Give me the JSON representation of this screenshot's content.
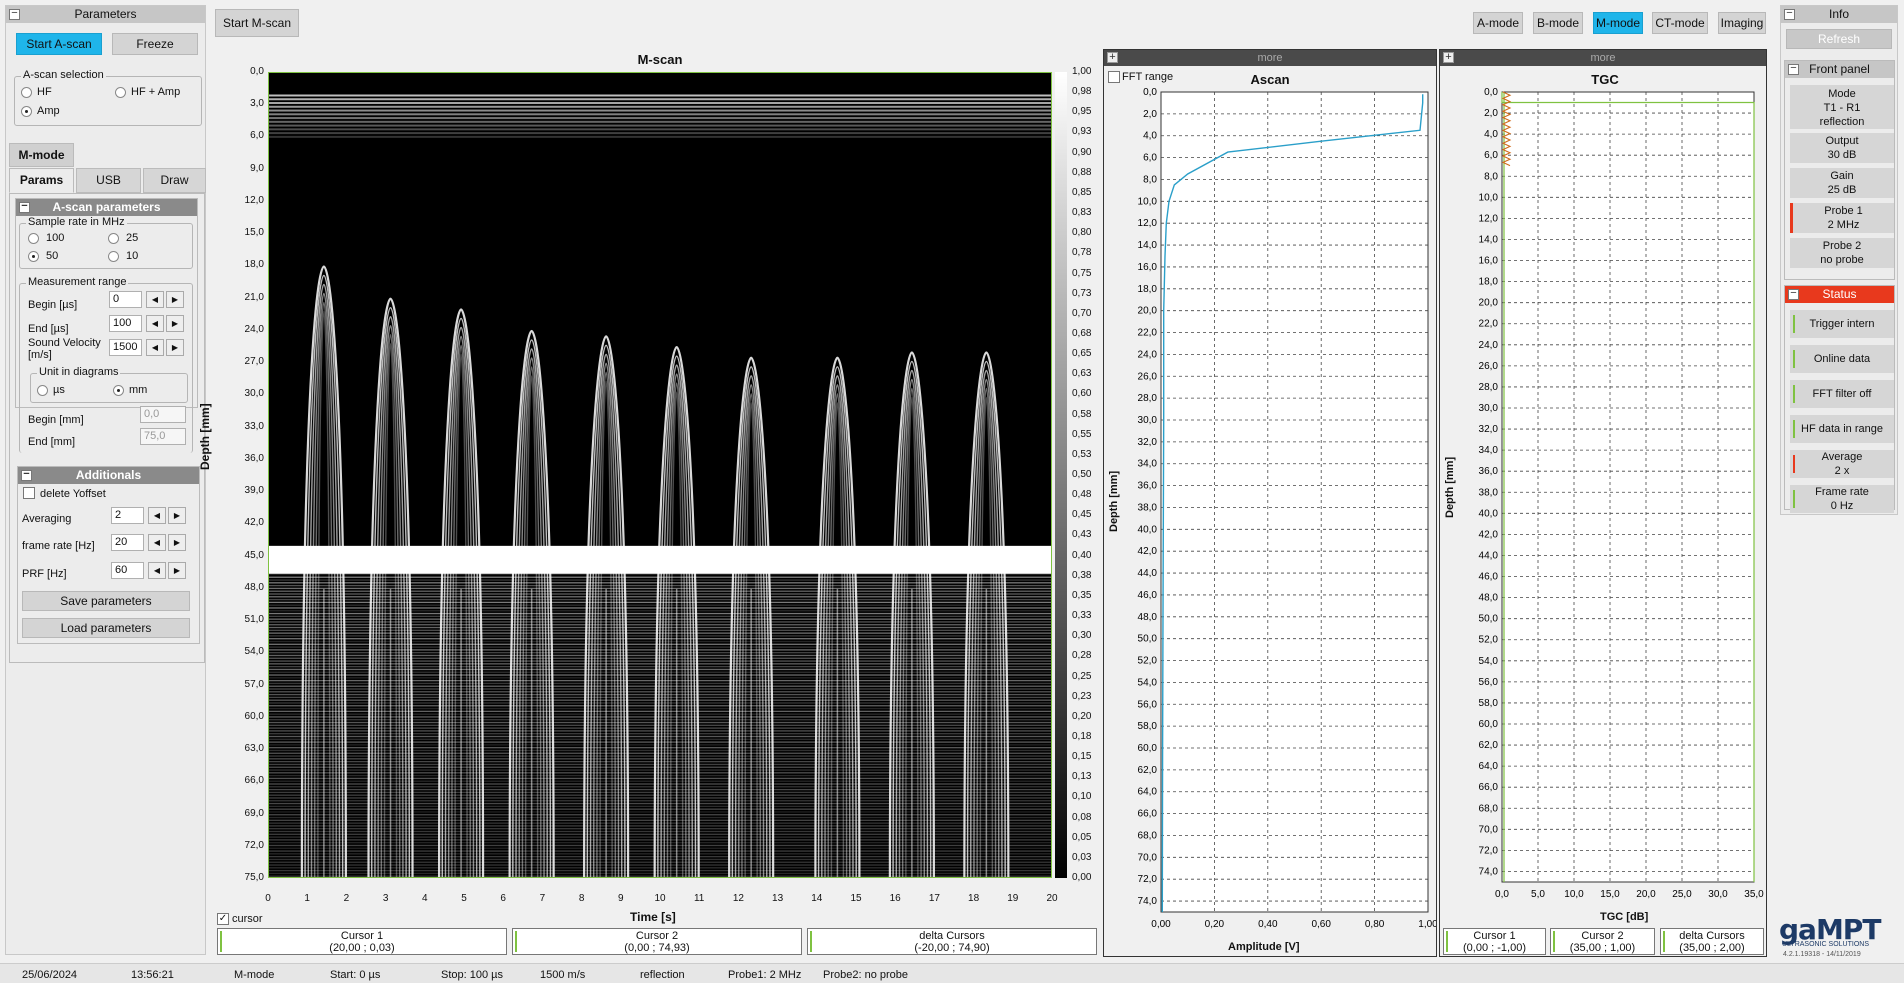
{
  "toolbar": {
    "start_mscan": "Start M-scan",
    "modes": [
      "A-mode",
      "B-mode",
      "M-mode",
      "CT-mode",
      "Imaging"
    ],
    "active_mode": "M-mode"
  },
  "parameters": {
    "title": "Parameters",
    "start_ascan": "Start A-scan",
    "freeze": "Freeze",
    "ascan_selection": {
      "label": "A-scan selection",
      "opt_hf": "HF",
      "opt_hfamp": "HF + Amp",
      "opt_amp": "Amp",
      "selected": "Amp"
    },
    "mode_tab": "M-mode",
    "tabs": [
      "Params",
      "USB",
      "Draw"
    ],
    "ascan_params": {
      "title": "A-scan parameters",
      "sample_rate": {
        "label": "Sample rate  in MHz",
        "opts": [
          "100",
          "25",
          "50",
          "10"
        ],
        "selected": "50"
      },
      "measurement": {
        "label": "Measurement range",
        "begin_label": "Begin [µs]",
        "begin_value": "0",
        "end_label": "End [µs]",
        "end_value": "100",
        "sv_label_1": "Sound Velocity",
        "sv_label_2": "[m/s]",
        "sv_value": "1500",
        "unit_label": "Unit in diagrams",
        "unit_us": "µs",
        "unit_mm": "mm",
        "unit_selected": "mm",
        "begin_mm_label": "Begin [mm]",
        "begin_mm_value": "0,0",
        "end_mm_label": "End [mm]",
        "end_mm_value": "75,0"
      }
    },
    "additionals": {
      "title": "Additionals",
      "delete_yoffset": "delete Yoffset",
      "averaging_label": "Averaging",
      "averaging_value": "2",
      "frame_rate_label": "frame rate [Hz]",
      "frame_rate_value": "20",
      "prf_label": "PRF [Hz]",
      "prf_value": "60",
      "save": "Save parameters",
      "load": "Load parameters"
    }
  },
  "mscan": {
    "title": "M-scan",
    "xlabel": "Time [s]",
    "ylabel": "Depth [mm]",
    "y_ticks": [
      "0,0",
      "3,0",
      "6,0",
      "9,0",
      "12,0",
      "15,0",
      "18,0",
      "21,0",
      "24,0",
      "27,0",
      "30,0",
      "33,0",
      "36,0",
      "39,0",
      "42,0",
      "45,0",
      "48,0",
      "51,0",
      "54,0",
      "57,0",
      "60,0",
      "63,0",
      "66,0",
      "69,0",
      "72,0",
      "75,0"
    ],
    "x_ticks": [
      "0",
      "1",
      "2",
      "3",
      "4",
      "5",
      "6",
      "7",
      "8",
      "9",
      "10",
      "11",
      "12",
      "13",
      "14",
      "15",
      "16",
      "17",
      "18",
      "19",
      "20"
    ],
    "scale_ticks": [
      "1,00",
      "0,98",
      "0,95",
      "0,93",
      "0,90",
      "0,88",
      "0,85",
      "0,83",
      "0,80",
      "0,78",
      "0,75",
      "0,73",
      "0,70",
      "0,68",
      "0,65",
      "0,63",
      "0,60",
      "0,58",
      "0,55",
      "0,53",
      "0,50",
      "0,48",
      "0,45",
      "0,43",
      "0,40",
      "0,38",
      "0,35",
      "0,33",
      "0,30",
      "0,28",
      "0,25",
      "0,23",
      "0,20",
      "0,18",
      "0,15",
      "0,13",
      "0,10",
      "0,08",
      "0,05",
      "0,03",
      "0,00"
    ],
    "cursor_check": "cursor",
    "cursors": [
      {
        "name": "Cursor 1",
        "val": "(20,00 ; 0,03)"
      },
      {
        "name": "Cursor 2",
        "val": "(0,00 ; 74,93)"
      },
      {
        "name": "delta Cursors",
        "val": "(-20,00 ; 74,90)"
      }
    ]
  },
  "depth_ticks": [
    "0,0",
    "2,0",
    "4,0",
    "6,0",
    "8,0",
    "10,0",
    "12,0",
    "14,0",
    "16,0",
    "18,0",
    "20,0",
    "22,0",
    "24,0",
    "26,0",
    "28,0",
    "30,0",
    "32,0",
    "34,0",
    "36,0",
    "38,0",
    "40,0",
    "42,0",
    "44,0",
    "46,0",
    "48,0",
    "50,0",
    "52,0",
    "54,0",
    "56,0",
    "58,0",
    "60,0",
    "62,0",
    "64,0",
    "66,0",
    "68,0",
    "70,0",
    "72,0",
    "74,0"
  ],
  "ascan": {
    "more": "more",
    "fft_range": "FFT range",
    "title": "Ascan",
    "xlabel": "Amplitude [V]",
    "ylabel": "Depth [mm]",
    "x_ticks": [
      "0,00",
      "0,20",
      "0,40",
      "0,60",
      "0,80",
      "1,00"
    ]
  },
  "tgc": {
    "more": "more",
    "title": "TGC",
    "xlabel": "TGC [dB]",
    "ylabel": "Depth [mm]",
    "x_ticks": [
      "0,0",
      "5,0",
      "10,0",
      "15,0",
      "20,0",
      "25,0",
      "30,0",
      "35,0"
    ],
    "cursors": [
      {
        "name": "Cursor 1",
        "val": "(0,00 ; -1,00)"
      },
      {
        "name": "Cursor 2",
        "val": "(35,00 ; 1,00)"
      },
      {
        "name": "delta Cursors",
        "val": "(35,00 ; 2,00)"
      }
    ]
  },
  "info": {
    "title": "Info",
    "refresh": "Refresh",
    "front_panel": "Front panel",
    "mode": [
      "Mode",
      "T1 - R1",
      "reflection"
    ],
    "output": [
      "Output",
      "30 dB"
    ],
    "gain": [
      "Gain",
      "25 dB"
    ],
    "probe1": [
      "Probe 1",
      "2 MHz"
    ],
    "probe2": [
      "Probe 2",
      "no probe"
    ],
    "status_title": "Status",
    "status": [
      [
        "Trigger intern"
      ],
      [
        "Online data"
      ],
      [
        "FFT filter off"
      ],
      [
        "HF data in range"
      ],
      [
        "Average",
        "2 x"
      ],
      [
        "Frame rate",
        "0 Hz"
      ]
    ],
    "logo": "gaMPT",
    "logo_sub": "ULTRASONIC SOLUTIONS",
    "version": "4.2.1.19318 - 14/11/2019"
  },
  "statusbar": [
    "25/06/2024",
    "13:56:21",
    "M-mode",
    "Start: 0 µs",
    "Stop: 100 µs",
    "1500 m/s",
    "reflection",
    "Probe1: 2 MHz",
    "Probe2: no probe"
  ],
  "colors": {
    "accent": "#1fb5ea",
    "status_red": "#e8391d",
    "status_green": "#7fc241",
    "ascan_line": "#2a9fc9",
    "tgc_line": "#d06a1a"
  },
  "chart_data": [
    {
      "type": "heatmap",
      "title": "M-scan",
      "xlabel": "Time [s]",
      "ylabel": "Depth [mm]",
      "xlim": [
        0,
        20
      ],
      "ylim": [
        0,
        75
      ],
      "colorbar": [
        0,
        1
      ]
    },
    {
      "type": "line",
      "title": "Ascan",
      "xlabel": "Amplitude [V]",
      "ylabel": "Depth [mm]",
      "xlim": [
        0,
        1
      ],
      "ylim": [
        0,
        75
      ],
      "x": [
        0.98,
        0.98,
        0.97,
        0.6,
        0.25,
        0.1,
        0.05,
        0.03,
        0.02,
        0.015,
        0.01,
        0.01,
        0.008,
        0.006,
        0.005
      ],
      "y": [
        0.2,
        1.0,
        3.5,
        4.5,
        5.5,
        7.5,
        8.5,
        10,
        12,
        15,
        20,
        30,
        45,
        60,
        75
      ]
    },
    {
      "type": "line",
      "title": "TGC",
      "xlabel": "TGC [dB]",
      "ylabel": "Depth [mm]",
      "xlim": [
        0,
        35
      ],
      "ylim": [
        0,
        75
      ],
      "x": [
        0,
        0,
        35,
        35
      ],
      "y": [
        0,
        1,
        1,
        75
      ]
    }
  ]
}
